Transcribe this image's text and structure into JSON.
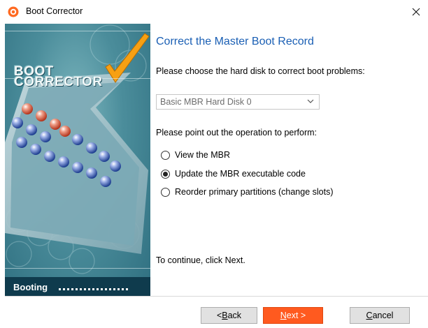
{
  "window": {
    "title": "Boot Corrector",
    "close_glyph": "×"
  },
  "sidebar": {
    "brand_line1": "BOOT",
    "brand_line2": "CORRECTOR",
    "booting_label": "Booting",
    "colors": {
      "accent_orange": "#ff5a1f",
      "teal": "#4b8d9b",
      "dark_band": "#0f3b4d",
      "checkmark": "#f7a013"
    }
  },
  "main": {
    "heading": "Correct the Master Boot Record",
    "choose_disk_label": "Please choose the hard disk to correct boot problems:",
    "disk_select": {
      "selected": "Basic MBR Hard Disk 0"
    },
    "operation_label": "Please point out the operation to perform:",
    "options": [
      {
        "label": "View the MBR",
        "checked": false
      },
      {
        "label": "Update the MBR executable code",
        "checked": true
      },
      {
        "label": "Reorder primary partitions (change slots)",
        "checked": false
      }
    ],
    "continue_text": "To continue, click Next."
  },
  "footer": {
    "back": {
      "prefix": "< ",
      "mnemonic": "B",
      "rest": "ack"
    },
    "next": {
      "mnemonic": "N",
      "rest": "ext >"
    },
    "cancel": {
      "mnemonic": "C",
      "rest": "ancel"
    }
  }
}
